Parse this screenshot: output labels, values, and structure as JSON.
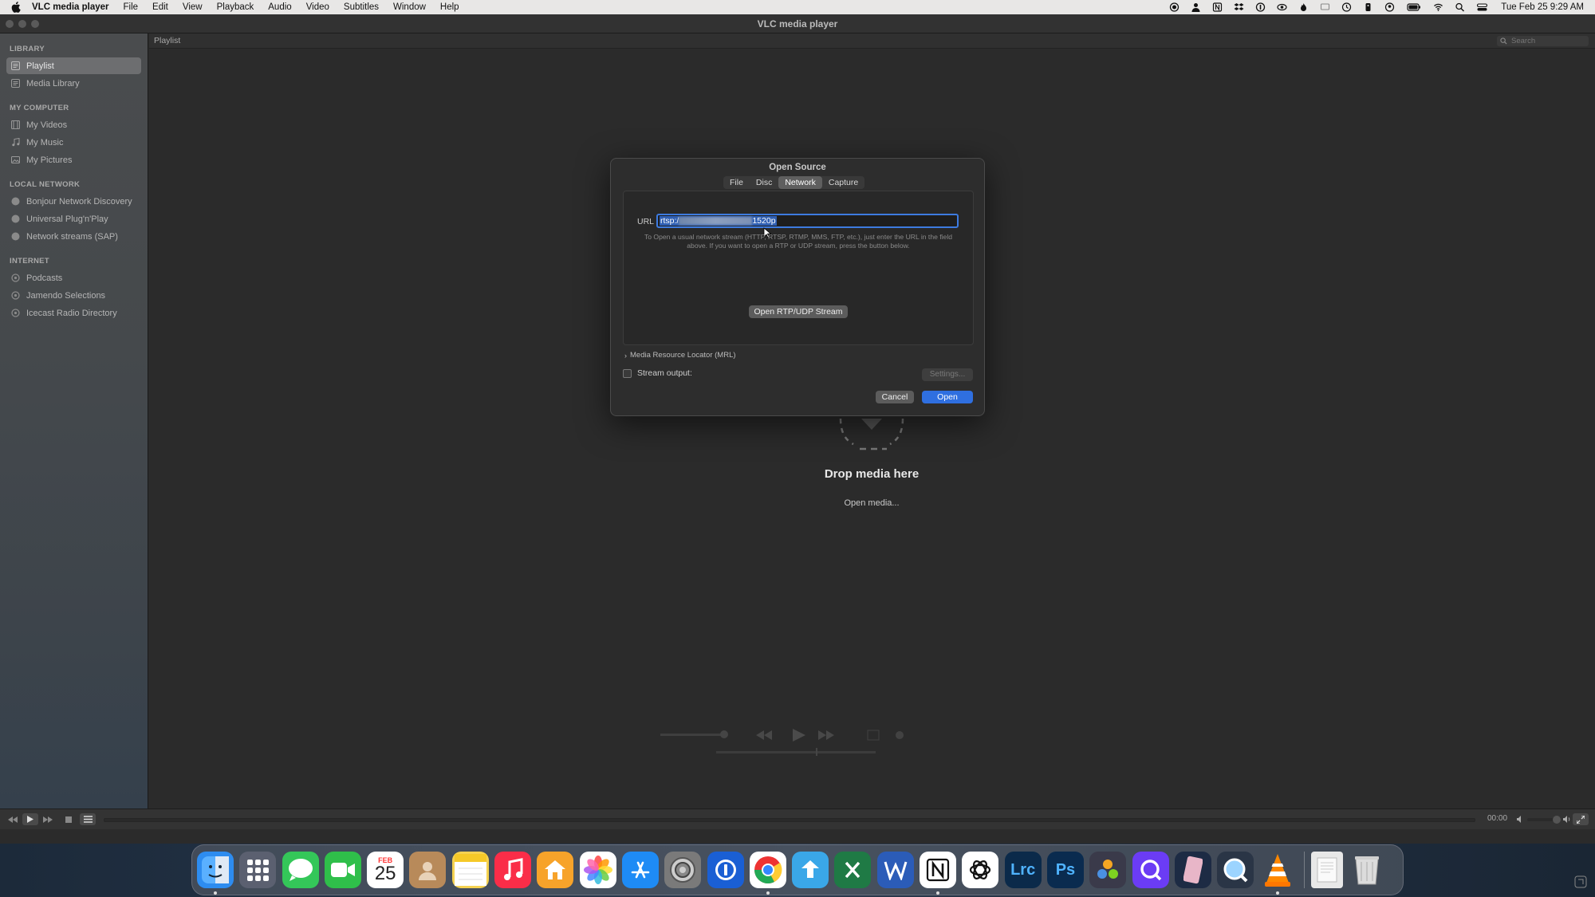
{
  "menubar": {
    "app_name": "VLC media player",
    "items": [
      "File",
      "Edit",
      "View",
      "Playback",
      "Audio",
      "Video",
      "Subtitles",
      "Window",
      "Help"
    ],
    "clock": "Tue Feb 25  9:29 AM"
  },
  "window": {
    "title": "VLC media player"
  },
  "sidebar": {
    "sections": [
      {
        "header": "LIBRARY",
        "items": [
          {
            "label": "Playlist",
            "icon": "playlist-icon",
            "active": true
          },
          {
            "label": "Media Library",
            "icon": "media-library-icon",
            "active": false
          }
        ]
      },
      {
        "header": "MY COMPUTER",
        "items": [
          {
            "label": "My Videos",
            "icon": "film-icon",
            "active": false
          },
          {
            "label": "My Music",
            "icon": "music-note-icon",
            "active": false
          },
          {
            "label": "My Pictures",
            "icon": "picture-icon",
            "active": false
          }
        ]
      },
      {
        "header": "LOCAL NETWORK",
        "items": [
          {
            "label": "Bonjour Network Discovery",
            "icon": "network-globe-icon",
            "active": false
          },
          {
            "label": "Universal Plug'n'Play",
            "icon": "network-globe-icon",
            "active": false
          },
          {
            "label": "Network streams (SAP)",
            "icon": "network-globe-icon",
            "active": false
          }
        ]
      },
      {
        "header": "INTERNET",
        "items": [
          {
            "label": "Podcasts",
            "icon": "podcast-icon",
            "active": false
          },
          {
            "label": "Jamendo Selections",
            "icon": "podcast-icon",
            "active": false
          },
          {
            "label": "Icecast Radio Directory",
            "icon": "podcast-icon",
            "active": false
          }
        ]
      }
    ]
  },
  "main": {
    "playlist_label": "Playlist",
    "search_placeholder": "Search",
    "drop_text": "Drop media here",
    "open_media": "Open media..."
  },
  "bottombar": {
    "time": "00:00"
  },
  "dialog": {
    "title": "Open Source",
    "tabs": [
      {
        "label": "File",
        "active": false
      },
      {
        "label": "Disc",
        "active": false
      },
      {
        "label": "Network",
        "active": true
      },
      {
        "label": "Capture",
        "active": false
      }
    ],
    "url_label": "URL",
    "url_prefix": "rtsp:/",
    "url_suffix": "1520p",
    "help_text": "To Open a usual network stream (HTTP, RTSP, RTMP, MMS, FTP, etc.), just enter the URL in the field above. If you want to open a RTP or UDP stream, press the button below.",
    "rtp_button": "Open RTP/UDP Stream",
    "mrl_label": "Media Resource Locator (MRL)",
    "stream_output_label": "Stream output:",
    "settings_button": "Settings...",
    "cancel_button": "Cancel",
    "open_button": "Open"
  },
  "dock": {
    "apps": [
      {
        "name": "finder-icon",
        "color": "#2d8cf0",
        "running": true
      },
      {
        "name": "launchpad-icon",
        "color": "#5b6070",
        "running": false
      },
      {
        "name": "messages-icon",
        "color": "#34c759",
        "running": false
      },
      {
        "name": "facetime-icon",
        "color": "#2fbf4a",
        "running": false
      },
      {
        "name": "calendar-icon",
        "color": "#ffffff",
        "running": false,
        "text": "25",
        "subtext": "FEB"
      },
      {
        "name": "contacts-icon",
        "color": "#b88a5a",
        "running": false
      },
      {
        "name": "notes-icon",
        "color": "#f5d251",
        "running": false
      },
      {
        "name": "music-icon",
        "color": "#fa2d48",
        "running": false
      },
      {
        "name": "home-icon",
        "color": "#f7a32a",
        "running": false
      },
      {
        "name": "photos-icon",
        "color": "#ffffff",
        "running": false
      },
      {
        "name": "app-store-icon",
        "color": "#1e8bf5",
        "running": false
      },
      {
        "name": "system-settings-icon",
        "color": "#7a7a7a",
        "running": false
      },
      {
        "name": "1password-icon",
        "color": "#1a5fd4",
        "running": false
      },
      {
        "name": "chrome-icon",
        "color": "#ffffff",
        "running": true
      },
      {
        "name": "transfer-icon",
        "color": "#3aa7e8",
        "running": false
      },
      {
        "name": "excel-icon",
        "color": "#1f7a45",
        "running": false
      },
      {
        "name": "word-icon",
        "color": "#2b5cb8",
        "running": false
      },
      {
        "name": "notion-icon",
        "color": "#ffffff",
        "running": true
      },
      {
        "name": "chatgpt-icon",
        "color": "#ffffff",
        "running": false
      },
      {
        "name": "lightroom-icon",
        "color": "#0b2a4a",
        "running": false,
        "text": "Lrc"
      },
      {
        "name": "photoshop-icon",
        "color": "#0a2b4f",
        "running": false,
        "text": "Ps"
      },
      {
        "name": "davinci-resolve-icon",
        "color": "#3a3a4a",
        "running": false
      },
      {
        "name": "quill-icon",
        "color": "#6b3cf5",
        "running": false
      },
      {
        "name": "screenshot-tool-icon",
        "color": "#1d2b44",
        "running": false
      },
      {
        "name": "quicktime-icon",
        "color": "#2a3546",
        "running": false
      },
      {
        "name": "vlc-icon",
        "color": "transparent",
        "running": true
      }
    ],
    "right": [
      {
        "name": "documents-folder-icon",
        "color": "#e8e8e8"
      },
      {
        "name": "trash-icon",
        "color": "#d9d9d9"
      }
    ]
  }
}
